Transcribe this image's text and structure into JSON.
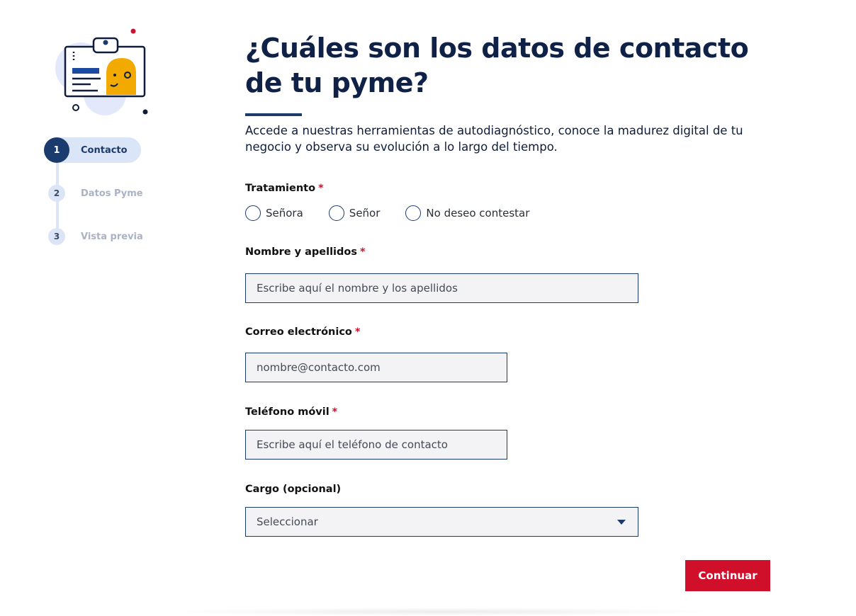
{
  "header": {
    "title": "¿Cuáles son los datos de contacto de tu pyme?",
    "intro": "Accede a nuestras herramientas de autodiagnóstico, conoce la madurez digital de tu negocio y observa su evolución a lo largo del tiempo."
  },
  "illustration": {
    "icon": "contact-card-icon"
  },
  "stepper": {
    "steps": [
      {
        "number": "1",
        "label": "Contacto",
        "state": "active"
      },
      {
        "number": "2",
        "label": "Datos Pyme",
        "state": "inactive"
      },
      {
        "number": "3",
        "label": "Vista previa",
        "state": "inactive"
      }
    ]
  },
  "form": {
    "required_mark": "*",
    "treatment": {
      "label": "Tratamiento",
      "options": [
        "Señora",
        "Señor",
        "No deseo contestar"
      ]
    },
    "name": {
      "label": "Nombre y apellidos",
      "placeholder": "Escribe aquí el nombre y los apellidos",
      "value": ""
    },
    "email": {
      "label": "Correo electrónico",
      "placeholder": "nombre@contacto.com",
      "value": ""
    },
    "phone": {
      "label": "Teléfono móvil",
      "placeholder": "Escribe aquí el teléfono de contacto",
      "value": ""
    },
    "position": {
      "label": "Cargo (opcional)",
      "selected": "Seleccionar"
    },
    "submit_label": "Continuar"
  },
  "colors": {
    "primary": "#1b3a6e",
    "accent": "#d0102b",
    "input_bg": "#f3f3f6",
    "step_inactive": "#dbe5f5"
  }
}
